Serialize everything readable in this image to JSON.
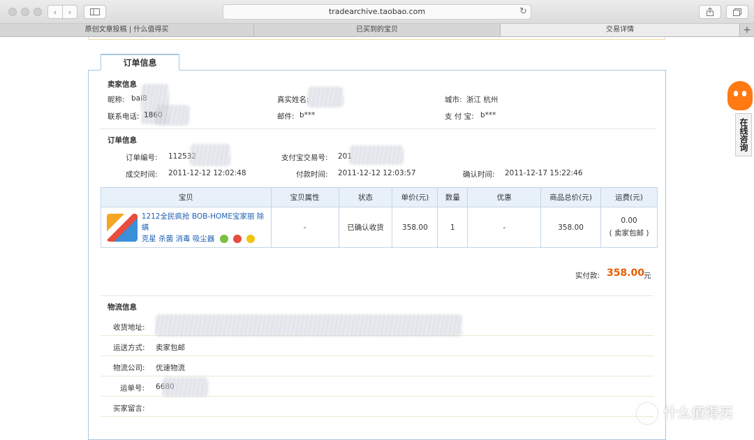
{
  "browser": {
    "url": "tradearchive.taobao.com",
    "tabs": [
      {
        "label": "原创文章投稿 | 什么值得买",
        "active": false
      },
      {
        "label": "已买到的宝贝",
        "active": false
      },
      {
        "label": "交易详情",
        "active": true
      }
    ],
    "new_tab": "+"
  },
  "section_tab": "订单信息",
  "seller": {
    "heading": "卖家信息",
    "nickname_label": "昵称:",
    "nickname_value": "bai8",
    "realname_label": "真实姓名:",
    "city_label": "城市:",
    "city_value": "浙江 杭州",
    "phone_label": "联系电话:",
    "phone_value": "1860",
    "email_label": "邮件:",
    "email_value": "b***",
    "alipay_label": "支 付 宝:",
    "alipay_value": "b***"
  },
  "order": {
    "heading": "订单信息",
    "order_no_label": "订单编号:",
    "order_no_value": "112532",
    "alipay_trade_label": "支付宝交易号:",
    "alipay_trade_value": "201",
    "deal_time_label": "成交时间:",
    "deal_time_value": "2011-12-12 12:02:48",
    "pay_time_label": "付款时间:",
    "pay_time_value": "2011-12-12 12:03:57",
    "confirm_time_label": "确认时间:",
    "confirm_time_value": "2011-12-17 15:22:46"
  },
  "items_table": {
    "headers": [
      "宝贝",
      "宝贝属性",
      "状态",
      "单价(元)",
      "数量",
      "优惠",
      "商品总价(元)",
      "运费(元)"
    ],
    "row": {
      "title_line1": "1212全民疯抢 BOB-HOME宝家丽 除螨",
      "title_line2": "克星 杀菌 消毒 吸尘器",
      "attributes": "-",
      "status": "已确认收货",
      "unit_price": "358.00",
      "quantity": "1",
      "discount": "-",
      "total": "358.00",
      "shipping_fee": "0.00",
      "shipping_note": "( 卖家包邮 )"
    }
  },
  "payment": {
    "label": "实付款:",
    "amount": "358.00",
    "unit": "元"
  },
  "logistics": {
    "heading": "物流信息",
    "address_label": "收货地址:",
    "method_label": "运送方式:",
    "method_value": "卖家包邮",
    "company_label": "物流公司:",
    "company_value": "优速物流",
    "tracking_label": "运单号:",
    "tracking_value": "6680",
    "message_label": "买家留言:"
  },
  "side_widget": {
    "label": "在线咨询"
  },
  "watermark": "什么值得买"
}
